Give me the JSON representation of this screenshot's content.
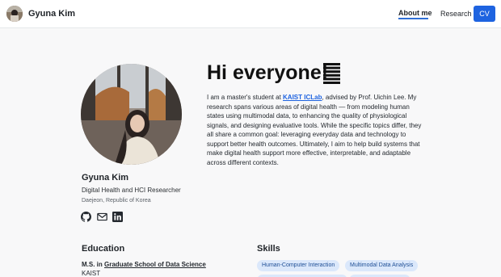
{
  "nav": {
    "brand": "Gyuna Kim",
    "about": "About me",
    "research": "Research",
    "cv": "CV"
  },
  "profile": {
    "name": "Gyuna Kim",
    "role": "Digital Health and HCI Researcher",
    "location": "Daejeon, Republic of Korea",
    "social_icons": [
      "github-icon",
      "mail-icon",
      "linkedin-icon"
    ]
  },
  "hero": {
    "greeting": "Hi everyone!"
  },
  "intro": {
    "part1": "I am a master's student at ",
    "lab": "KAIST ICLab",
    "part2": ", advised by Prof. Uichin Lee. My research spans various areas of digital health — from modeling human states using multimodal data, to enhancing the quality of physiological signals, and designing evaluative tools. While the specific topics differ, they all share a common goal: leveraging everyday data and technology to support better health outcomes. Ultimately, I aim to help build systems that make digital health support more effective, interpretable, and adaptable across different contexts."
  },
  "education": {
    "title": "Education",
    "degree": "M.S. in",
    "school_link": "Graduate School of Data Science",
    "institution": "KAIST"
  },
  "skills": {
    "title": "Skills",
    "items": [
      "Human-Computer Interaction",
      "Multimodal Data Analysis"
    ]
  },
  "colors": {
    "accent": "#1e63e0",
    "chip_bg": "#dbe8fb",
    "page_bg": "#f8f8f9"
  }
}
